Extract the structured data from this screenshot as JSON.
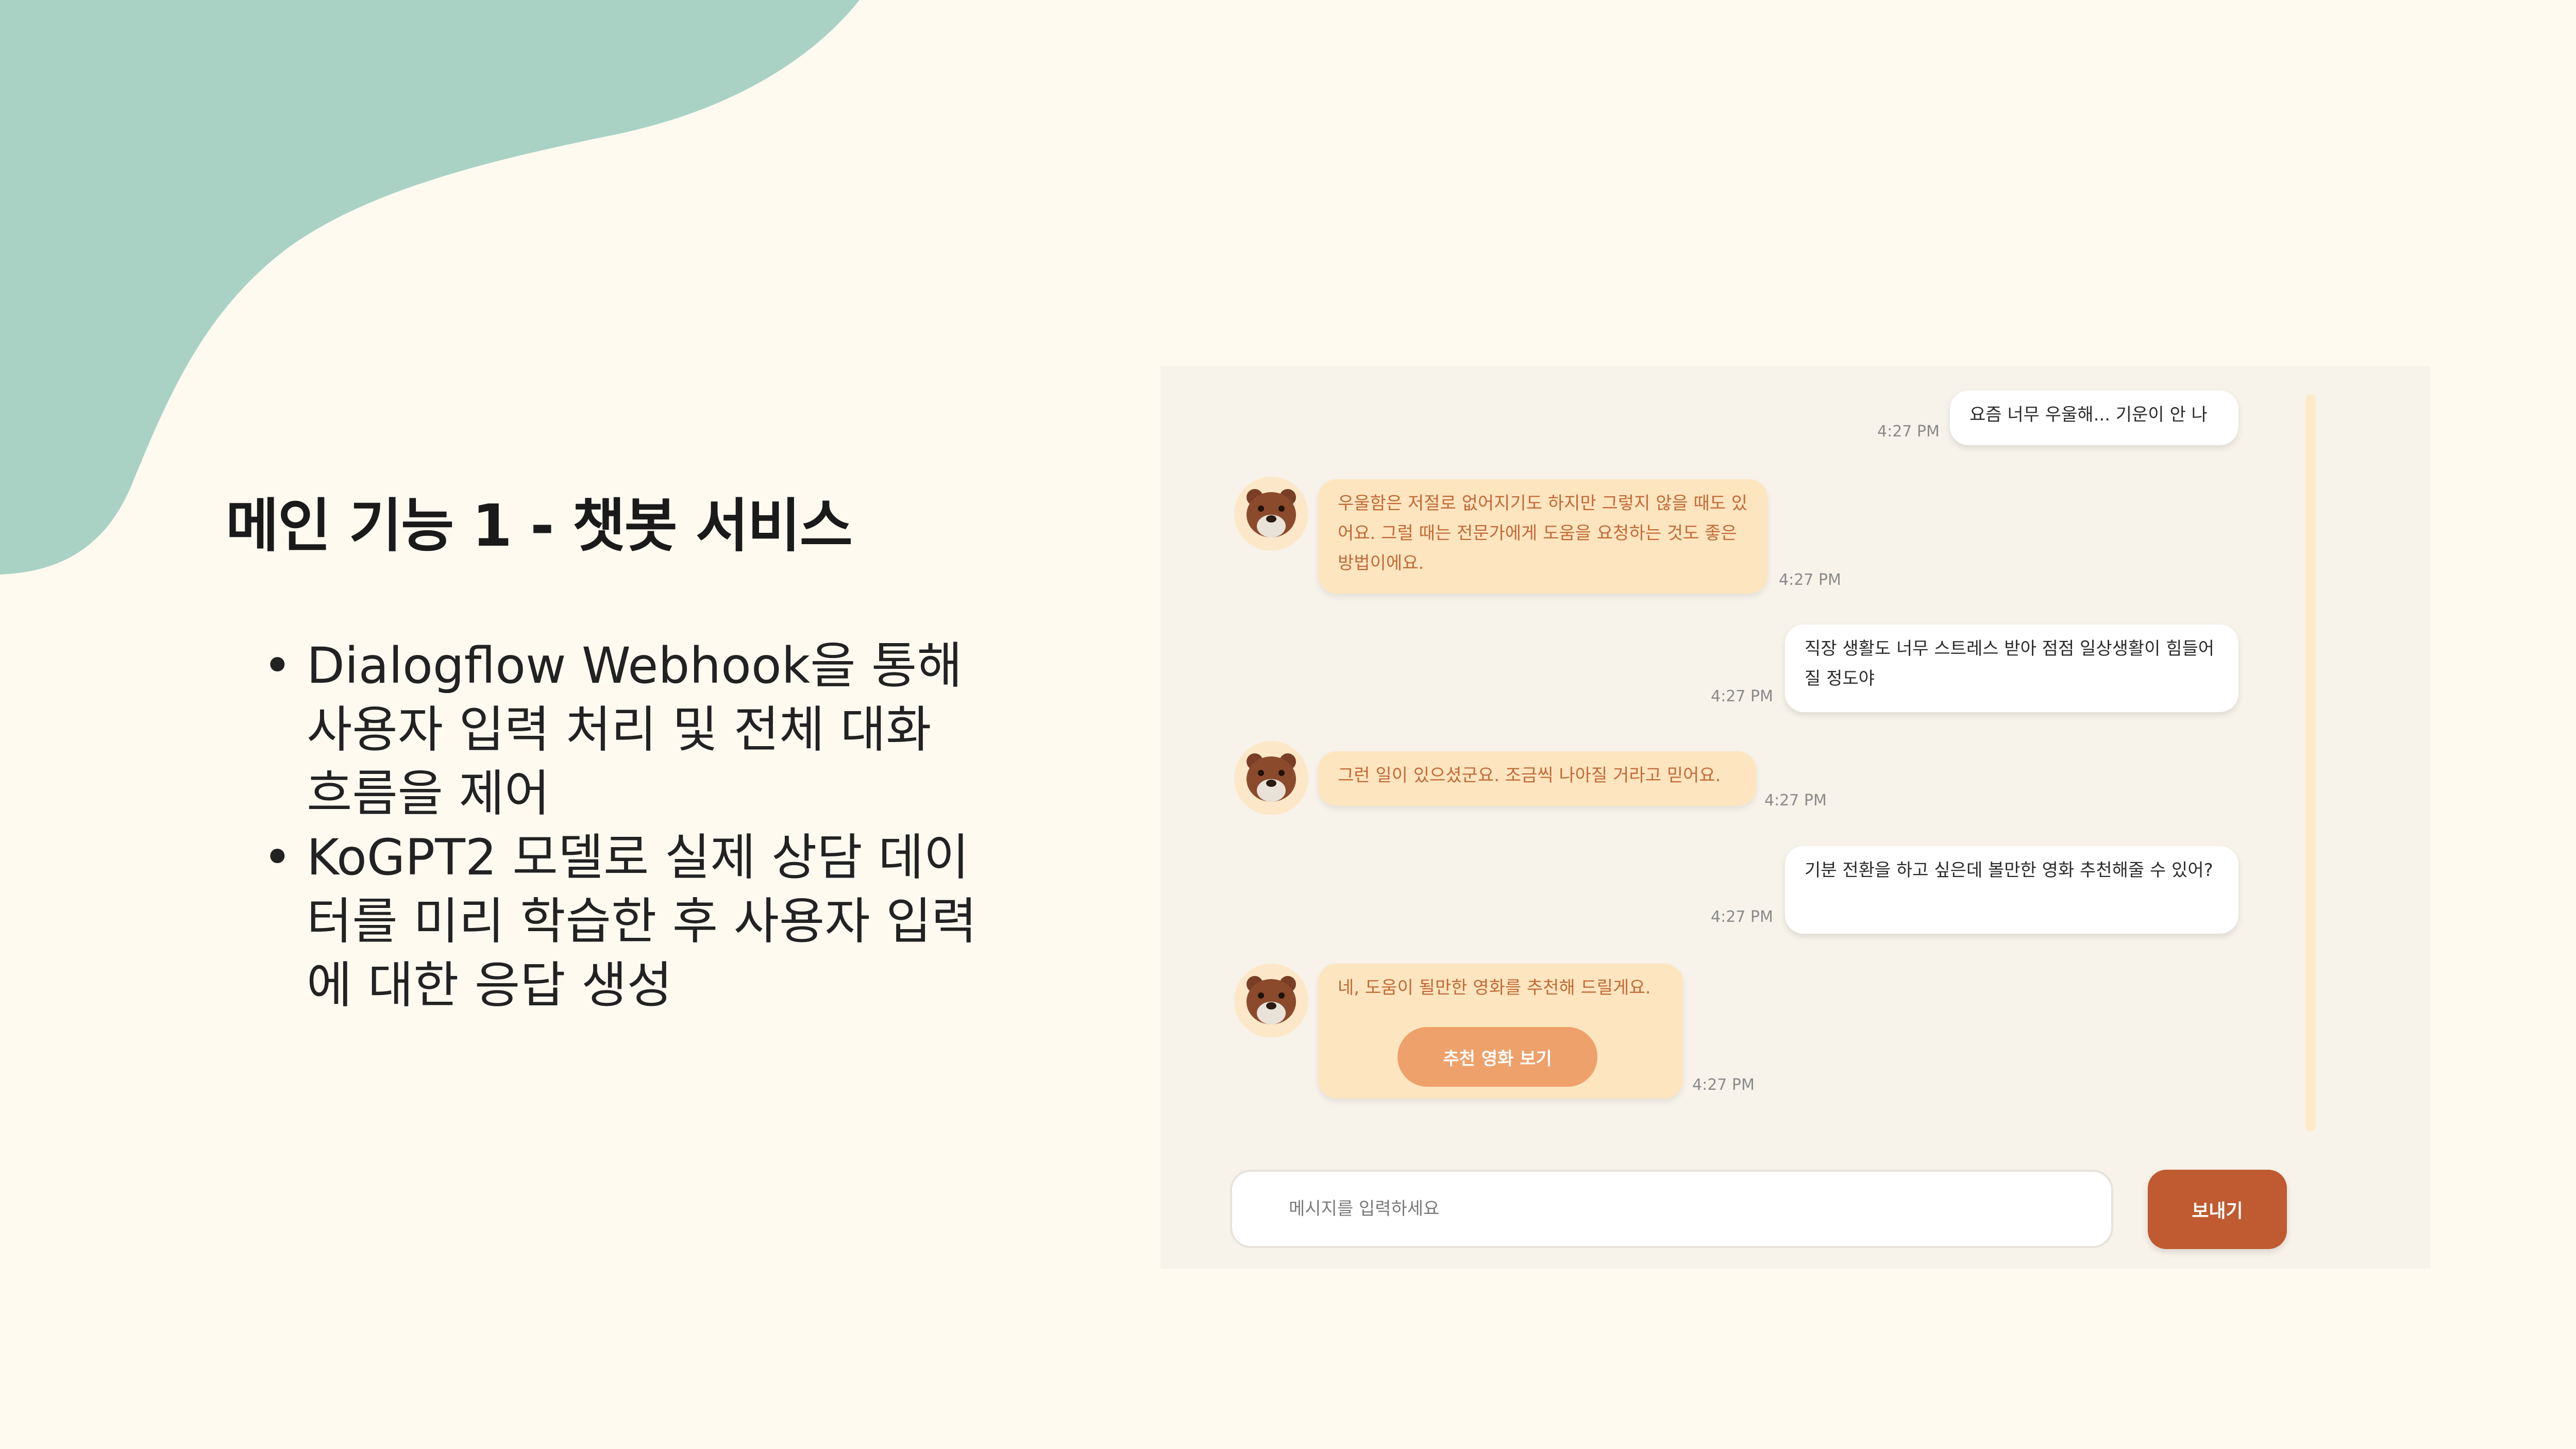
{
  "slide": {
    "title": "메인 기능 1 - 챗봇 서비스",
    "bullets": [
      "Dialogflow Webhook을 통해 사용자 입력 처리 및 전체 대화 흐름을 제어",
      "KoGPT2 모델로 실제 상담 데이터를 미리 학습한 후 사용자 입력에 대한 응답 생성"
    ]
  },
  "chat": {
    "messages": [
      {
        "sender": "user",
        "text": "요즘 너무 우울해... 기운이 안 나",
        "time": "4:27 PM"
      },
      {
        "sender": "bot",
        "text": "우울함은 저절로 없어지기도 하지만 그렇지 않을 때도 있어요. 그럴 때는 전문가에게 도움을 요청하는 것도 좋은 방법이에요.",
        "time": "4:27 PM"
      },
      {
        "sender": "user",
        "text": "직장 생활도 너무 스트레스 받아 점점 일상생활이 힘들어질 정도야",
        "time": "4:27 PM"
      },
      {
        "sender": "bot",
        "text": "그런 일이 있으셨군요. 조금씩 나아질 거라고 믿어요.",
        "time": "4:27 PM"
      },
      {
        "sender": "user",
        "text": "기분 전환을 하고 싶은데 볼만한 영화 추천해줄 수 있어?",
        "time": "4:27 PM"
      },
      {
        "sender": "bot",
        "text": "네, 도움이 될만한 영화를 추천해 드릴게요.",
        "time": "4:27 PM",
        "button_label": "추천 영화 보기"
      }
    ],
    "input": {
      "placeholder": "메시지를 입력하세요",
      "value": ""
    },
    "send_label": "보내기"
  },
  "colors": {
    "background": "#FEFAF0",
    "blob": "#A9D2C5",
    "chat_panel": "#F7F3EA",
    "bot_bubble": "#FDE5C0",
    "bot_text": "#C26A35",
    "user_bubble": "#FFFFFF",
    "recommend_button": "#EEA16A",
    "send_button": "#BF5A31"
  },
  "icons": {
    "bot_avatar": "bear-face-icon"
  }
}
